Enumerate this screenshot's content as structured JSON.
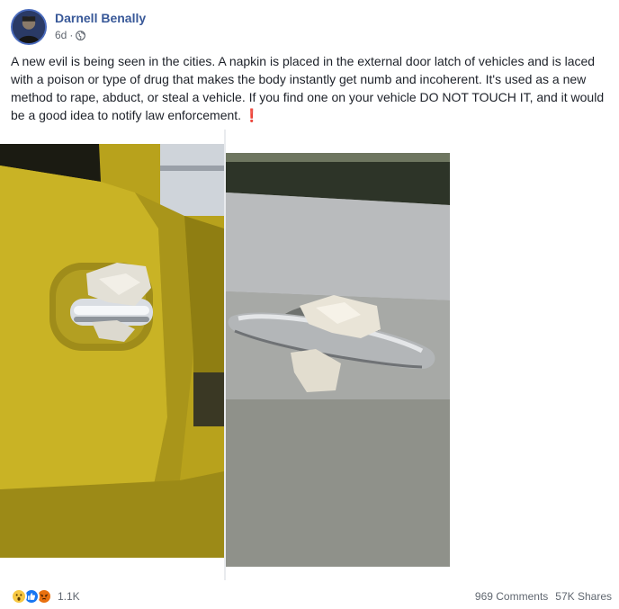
{
  "post": {
    "author": "Darnell Benally",
    "time": "6d",
    "separator": "·",
    "privacy_icon": "globe-icon",
    "text": "A new evil is being seen in the cities. A napkin is placed in the external door latch of vehicles and is laced with a poison or type of drug that makes the body instantly get numb and incoherent. It's used as a new method to rape, abduct, or steal a vehicle. If you find one on your vehicle DO NOT TOUCH IT, and it would be a good idea to notify law enforcement.",
    "emoji": "❗"
  },
  "photos": [
    {
      "icon": "photo-yellow-truck-door-napkin"
    },
    {
      "icon": "photo-silver-car-door-napkin"
    }
  ],
  "footer": {
    "reactions": [
      "wow-reaction-icon",
      "like-reaction-icon",
      "angry-reaction-icon"
    ],
    "reaction_count": "1.1K",
    "comments": "969 Comments",
    "shares": "57K Shares"
  },
  "colors": {
    "author_link": "#385898",
    "like_blue": "#1877f2",
    "wow_yellow": "#f7c843",
    "angry_orange": "#e9710f",
    "exclaim_red": "#e0192a"
  }
}
